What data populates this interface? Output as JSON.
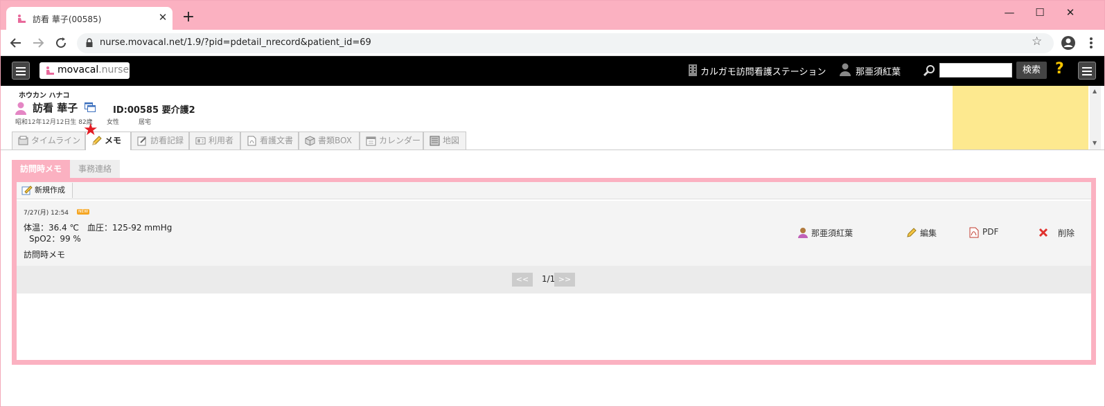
{
  "browser": {
    "tab_title": "訪看 華子(00585)",
    "tab_close": "✕",
    "new_tab": "+",
    "win_min": "—",
    "win_max": "☐",
    "win_close": "✕",
    "url": "nurse.movacal.net/1.9/?pid=pdetail_nrecord&patient_id=69"
  },
  "header": {
    "logo_main": "movacal",
    "logo_suffix": ".nurse",
    "station": "カルガモ訪問看護ステーション",
    "user": "那亜須紅葉",
    "search_button": "検索",
    "search_value": "",
    "help": "?"
  },
  "patient": {
    "kana": "ホウカン ハナコ",
    "name": "訪看 華子",
    "id_care": "ID:00585 要介護2",
    "birth_age": "昭和12年12月12日生 82歳",
    "sex": "女性",
    "residence": "居宅"
  },
  "patient_tabs": [
    {
      "label": "タイムライン",
      "active": false
    },
    {
      "label": "メモ",
      "active": true
    },
    {
      "label": "訪看記録",
      "active": false
    },
    {
      "label": "利用者",
      "active": false
    },
    {
      "label": "看護文書",
      "active": false
    },
    {
      "label": "書類BOX",
      "active": false
    },
    {
      "label": "カレンダー",
      "active": false
    },
    {
      "label": "地図",
      "active": false
    }
  ],
  "memo_tabs": [
    {
      "label": "訪問時メモ",
      "active": true
    },
    {
      "label": "事務連絡",
      "active": false
    }
  ],
  "toolbar": {
    "new_label": "新規作成"
  },
  "record": {
    "datetime": "7/27(月) 12:54",
    "new_badge": "NEW",
    "vitals_line1": "体温：36.4 ℃　血圧：125-92 mmHg",
    "vitals_line2": "SpO2：99 %",
    "title": "訪問時メモ",
    "author": "那亜須紅葉",
    "edit": "編集",
    "pdf": "PDF",
    "delete": "削除"
  },
  "pager": {
    "prev": "<<",
    "page": "1/1",
    "next": ">>"
  },
  "colors": {
    "accent_pink": "#fbb1c1",
    "header_black": "#000000",
    "note_yellow": "#fde98f",
    "star_red": "#e31b23"
  }
}
